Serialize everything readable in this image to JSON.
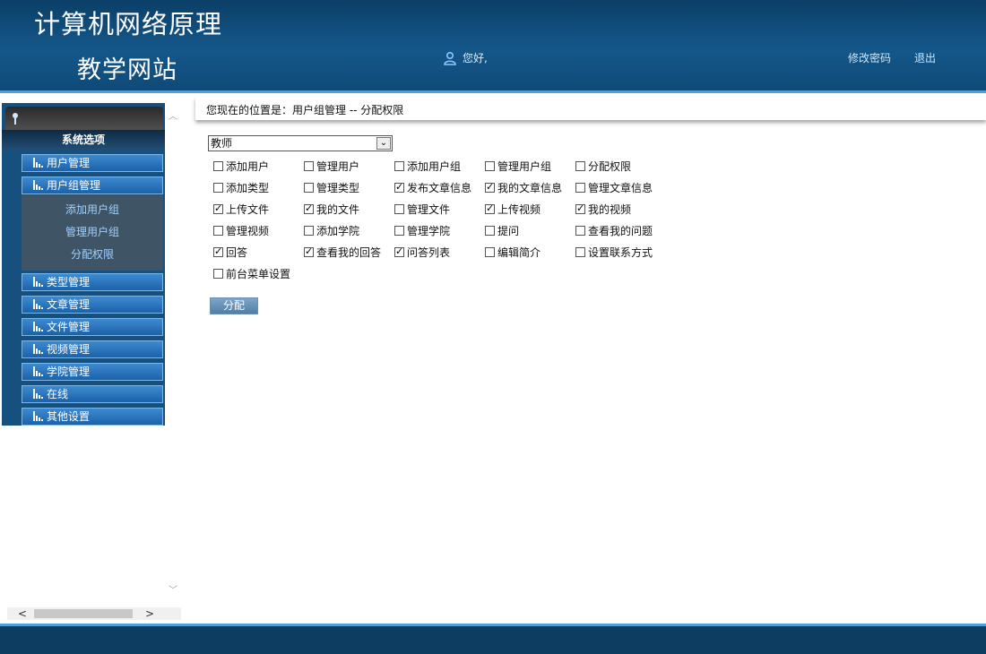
{
  "header": {
    "title_line1": "计算机网络原理",
    "title_line2": "教学网站",
    "greeting": "您好,",
    "change_password": "修改密码",
    "logout": "退出",
    "user_icon": "user-icon"
  },
  "sidebar": {
    "heading": "系统选项",
    "items": [
      {
        "label": "用户管理"
      },
      {
        "label": "用户组管理"
      },
      {
        "label": "类型管理"
      },
      {
        "label": "文章管理"
      },
      {
        "label": "文件管理"
      },
      {
        "label": "视频管理"
      },
      {
        "label": "学院管理"
      },
      {
        "label": "在线"
      },
      {
        "label": "其他设置"
      }
    ],
    "submenu": [
      {
        "label": "添加用户组"
      },
      {
        "label": "管理用户组"
      },
      {
        "label": "分配权限"
      }
    ],
    "scroll_left": "<",
    "scroll_right": ">"
  },
  "main": {
    "breadcrumb": "您现在的位置是：用户组管理 -- 分配权限",
    "role_select": "教师",
    "assign_button": "分配",
    "permissions": [
      {
        "label": "添加用户",
        "checked": false
      },
      {
        "label": "管理用户",
        "checked": false
      },
      {
        "label": "添加用户组",
        "checked": false
      },
      {
        "label": "管理用户组",
        "checked": false
      },
      {
        "label": "分配权限",
        "checked": false
      },
      {
        "label": "添加类型",
        "checked": false
      },
      {
        "label": "管理类型",
        "checked": false
      },
      {
        "label": "发布文章信息",
        "checked": true
      },
      {
        "label": "我的文章信息",
        "checked": true
      },
      {
        "label": "管理文章信息",
        "checked": false
      },
      {
        "label": "上传文件",
        "checked": true
      },
      {
        "label": "我的文件",
        "checked": true
      },
      {
        "label": "管理文件",
        "checked": false
      },
      {
        "label": "上传视频",
        "checked": true
      },
      {
        "label": "我的视频",
        "checked": true
      },
      {
        "label": "管理视频",
        "checked": false
      },
      {
        "label": "添加学院",
        "checked": false
      },
      {
        "label": "管理学院",
        "checked": false
      },
      {
        "label": "提问",
        "checked": false
      },
      {
        "label": "查看我的问题",
        "checked": false
      },
      {
        "label": "回答",
        "checked": true
      },
      {
        "label": "查看我的回答",
        "checked": true
      },
      {
        "label": "问答列表",
        "checked": true
      },
      {
        "label": "编辑简介",
        "checked": false
      },
      {
        "label": "设置联系方式",
        "checked": false
      },
      {
        "label": "前台菜单设置",
        "checked": false
      }
    ]
  },
  "colors": {
    "header_bg": "#14578a",
    "accent": "#4ea1dc",
    "menu_bg": "#1c62a8",
    "submenu_text": "#9fd0ff"
  }
}
